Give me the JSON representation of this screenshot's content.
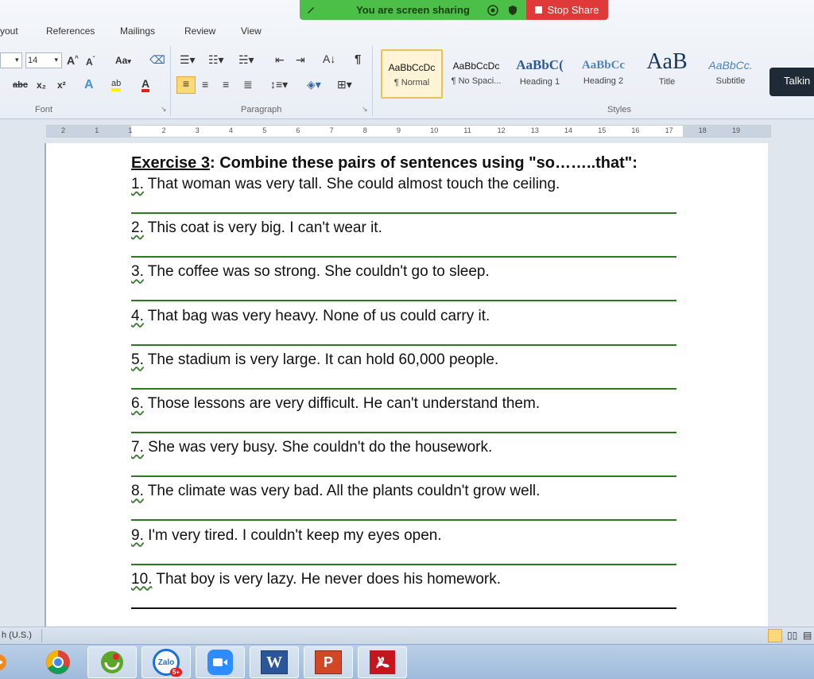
{
  "banner": {
    "sharing_text": "You are screen sharing",
    "stop_label": "Stop Share"
  },
  "tabs": [
    "yout",
    "References",
    "Mailings",
    "Review",
    "View"
  ],
  "font_group": {
    "label": "Font",
    "size": "14",
    "case_btn": "Aa",
    "strike": "abc",
    "sub": "x₂",
    "sup": "x²",
    "highlight": "ab",
    "font_color": "A"
  },
  "paragraph_group": {
    "label": "Paragraph"
  },
  "styles_group": {
    "label": "Styles",
    "items": [
      {
        "sample": "AaBbCcDc",
        "name": "¶ Normal"
      },
      {
        "sample": "AaBbCcDc",
        "name": "¶ No Spaci..."
      },
      {
        "sample": "AaBbC(",
        "name": "Heading 1"
      },
      {
        "sample": "AaBbCc",
        "name": "Heading 2"
      },
      {
        "sample": "AaB",
        "name": "Title"
      },
      {
        "sample": "AaBbCc.",
        "name": "Subtitle"
      }
    ]
  },
  "talking_tooltip": "Talkin",
  "document": {
    "title_prefix": "Exercise 3",
    "title_rest": ": Combine these pairs of sentences using \"so……..that\":",
    "exercises": [
      {
        "num": "1.",
        "text": " That woman was very tall. She could almost touch the ceiling."
      },
      {
        "num": "2.",
        "text": " This coat is very big. I can't wear it."
      },
      {
        "num": "3.",
        "text": " The coffee was so strong. She couldn't go to sleep."
      },
      {
        "num": "4.",
        "text": " That bag was very heavy. None of us could carry it."
      },
      {
        "num": "5.",
        "text": " The stadium is very large. It can hold 60,000 people."
      },
      {
        "num": "6.",
        "text": " Those lessons are very difficult. He can't understand them."
      },
      {
        "num": "7.",
        "text": " She was very busy. She couldn't do the housework."
      },
      {
        "num": "8.",
        "text": " The climate was very bad. All the plants couldn't grow well."
      },
      {
        "num": "9.",
        "text": " I'm very tired. I couldn't keep my eyes open."
      },
      {
        "num": "10.",
        "text": " That boy is very lazy. He never does his homework."
      }
    ]
  },
  "statusbar": {
    "language": "h (U.S.)"
  },
  "ruler_labels": [
    "2",
    "1",
    "1",
    "2",
    "3",
    "4",
    "5",
    "6",
    "7",
    "8",
    "9",
    "10",
    "11",
    "12",
    "13",
    "14",
    "15",
    "16",
    "17",
    "18",
    "19"
  ],
  "taskbar": {
    "items": [
      "media-player-icon",
      "chrome-icon",
      "unikey-icon",
      "zalo-icon",
      "zoom-icon",
      "word-icon",
      "powerpoint-icon",
      "acrobat-icon"
    ],
    "zalo_label": "Zalo",
    "zalo_badge": "5+"
  },
  "colors": {
    "share_green": "#4bbf47",
    "stop_red": "#e0393a",
    "answer_line": "#2b7a1f"
  }
}
